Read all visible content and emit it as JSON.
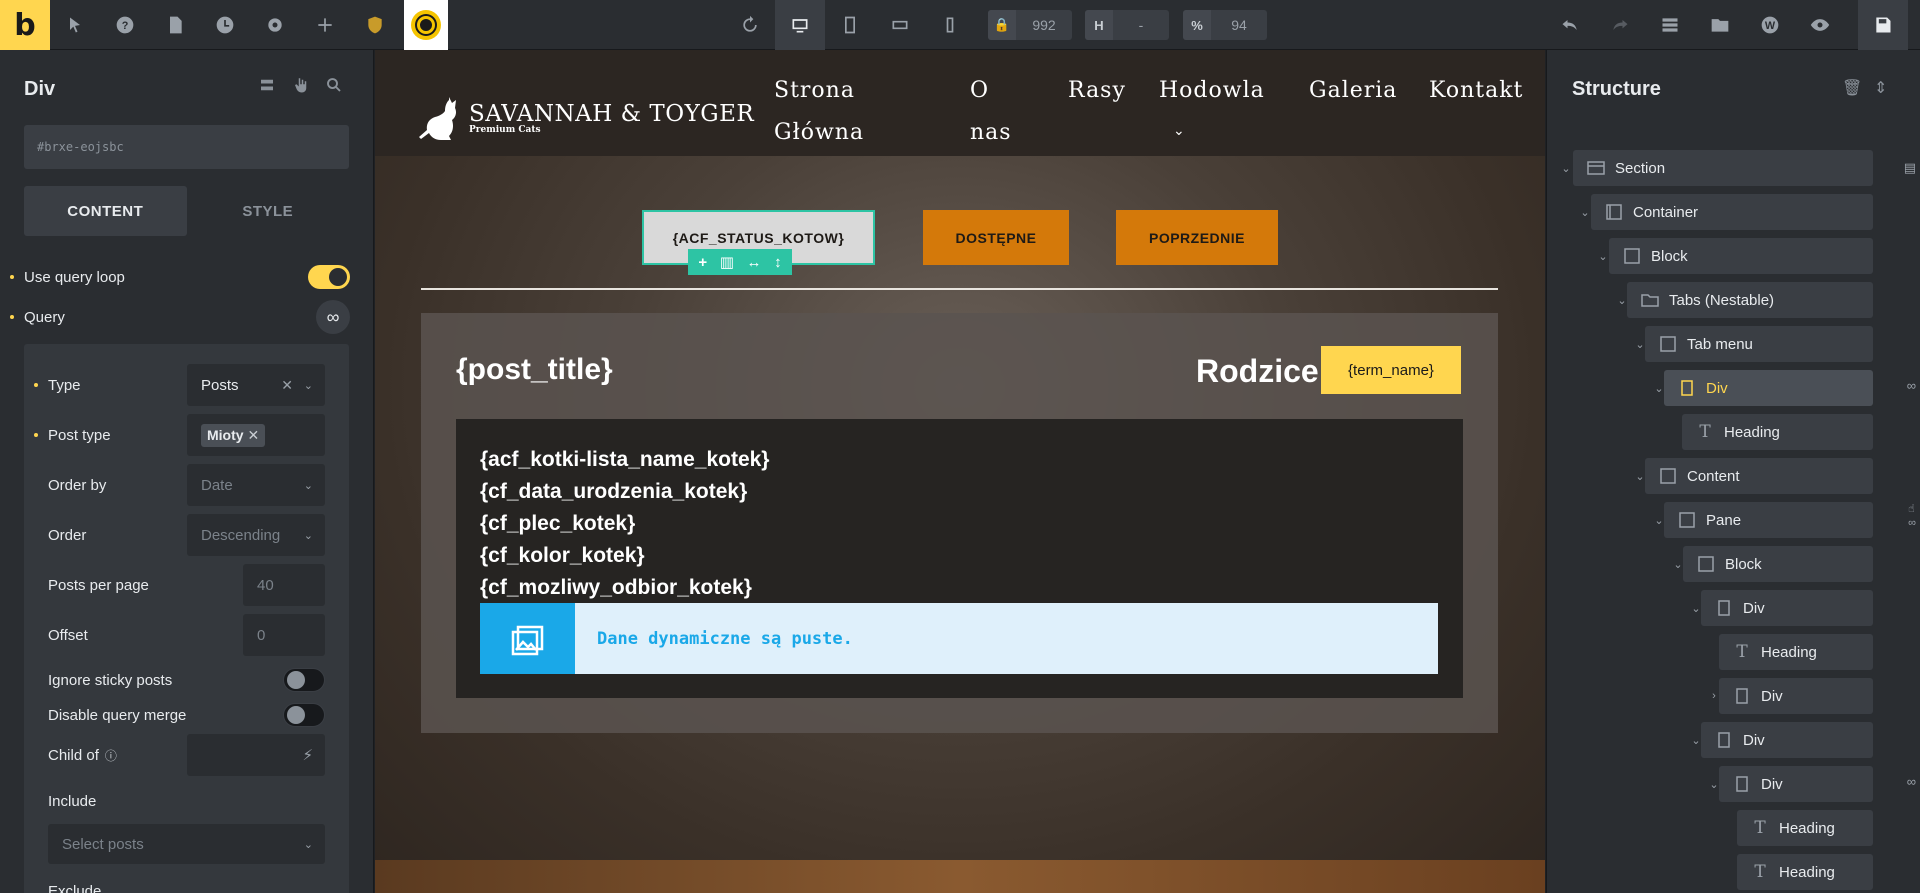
{
  "topbar": {
    "logo": "b",
    "width_value": "992",
    "height_prefix": "H",
    "height_value": "-",
    "percent_prefix": "%",
    "percent_value": "94"
  },
  "left": {
    "title": "Div",
    "css_id": "#brxe-eojsbc",
    "tab_content": "CONTENT",
    "tab_style": "STYLE",
    "use_query_loop": "Use query loop",
    "query": "Query",
    "query_icon": "∞",
    "type_label": "Type",
    "type_value": "Posts",
    "post_type_label": "Post type",
    "post_type_tag": "Mioty",
    "order_by_label": "Order by",
    "order_by_value": "Date",
    "order_label": "Order",
    "order_value": "Descending",
    "ppp_label": "Posts per page",
    "ppp_value": "40",
    "offset_label": "Offset",
    "offset_value": "0",
    "ignore_sticky": "Ignore sticky posts",
    "disable_merge": "Disable query merge",
    "child_of": "Child of",
    "include": "Include",
    "include_placeholder": "Select posts",
    "exclude": "Exclude"
  },
  "site": {
    "brand": "SAVANNAH & TOYGER",
    "tagline": "Premium Cats",
    "nav": [
      "Strona Główna",
      "O nas",
      "Rasy",
      "Hodowla",
      "Galeria",
      "Kontakt"
    ],
    "btn_status": "{ACF_STATUS_KOTOW}",
    "btn_available": "DOSTĘPNE",
    "btn_previous": "POPRZEDNIE",
    "post_title": "{post_title}",
    "parents": "Rodzice:",
    "term_name": "{term_name}",
    "acf_lines": [
      "{acf_kotki-lista_name_kotek}",
      "{cf_data_urodzenia_kotek}",
      "{cf_plec_kotek}",
      "{cf_kolor_kotek}",
      "{cf_mozliwy_odbior_kotek}"
    ],
    "empty_msg": "Dane dynamiczne są puste."
  },
  "structure": {
    "title": "Structure",
    "nodes": [
      "Section",
      "Container",
      "Block",
      "Tabs (Nestable)",
      "Tab menu",
      "Div",
      "Heading",
      "Content",
      "Pane",
      "Block",
      "Div",
      "Heading",
      "Div",
      "Div",
      "Div",
      "Heading",
      "Heading"
    ]
  }
}
